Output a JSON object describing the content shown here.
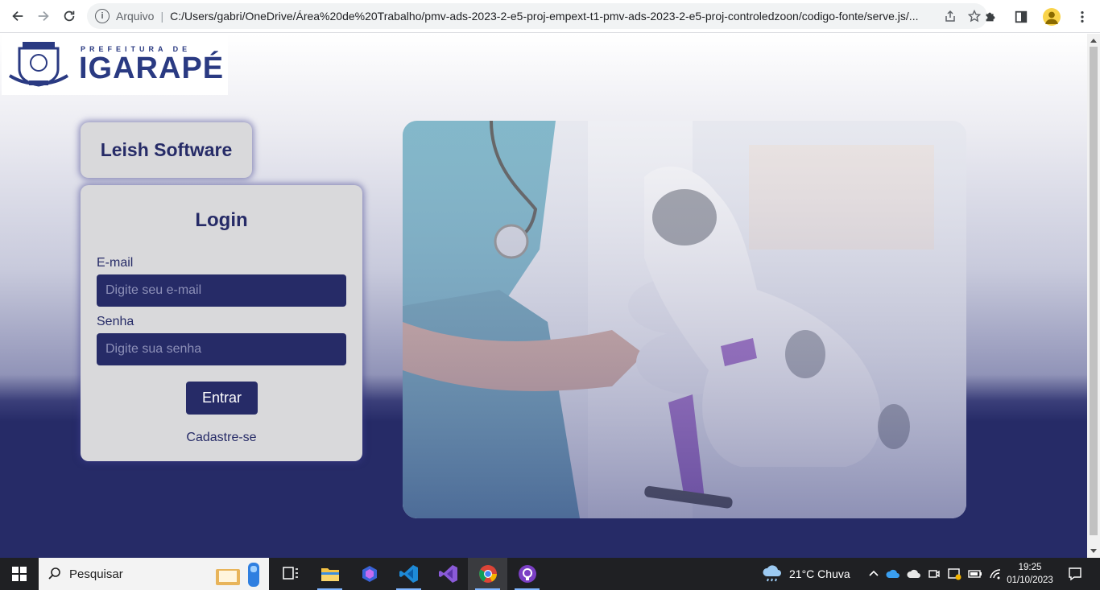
{
  "browser": {
    "scheme_label": "Arquivo",
    "url": "C:/Users/gabri/OneDrive/Área%20de%20Trabalho/pmv-ads-2023-2-e5-proj-empext-t1-pmv-ads-2023-2-e5-proj-controledzoon/codigo-fonte/serve.js/..."
  },
  "header": {
    "logo_top": "PREFEITURA DE",
    "logo_city": "IGARAPÉ"
  },
  "brand": {
    "title": "Leish Software"
  },
  "login": {
    "title": "Login",
    "email_label": "E-mail",
    "email_placeholder": "Digite seu e-mail",
    "password_label": "Senha",
    "password_placeholder": "Digite sua senha",
    "submit_label": "Entrar",
    "register_link": "Cadastre-se"
  },
  "taskbar": {
    "search_label": "Pesquisar",
    "weather": "21°C  Chuva",
    "time": "19:25",
    "date": "01/10/2023"
  },
  "colors": {
    "primary": "#262b67",
    "card": "#d9d9db",
    "taskbar": "#1f2023"
  }
}
